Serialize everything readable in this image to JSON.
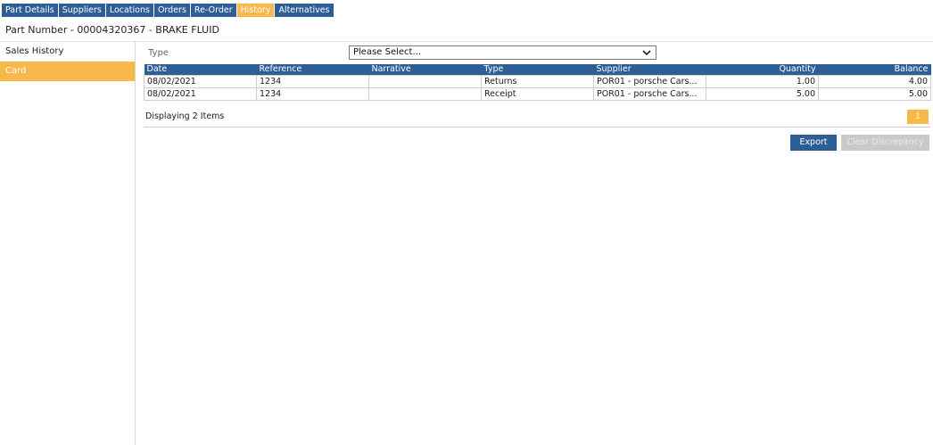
{
  "tabs": [
    {
      "label": "Part Details",
      "active": false
    },
    {
      "label": "Suppliers",
      "active": false
    },
    {
      "label": "Locations",
      "active": false
    },
    {
      "label": "Orders",
      "active": false
    },
    {
      "label": "Re-Order",
      "active": false
    },
    {
      "label": "History",
      "active": true
    },
    {
      "label": "Alternatives",
      "active": false
    }
  ],
  "header": {
    "title": "Part Number - 00004320367 - BRAKE FLUID"
  },
  "sidebar": {
    "items": [
      {
        "label": "Sales History",
        "active": false
      },
      {
        "label": "Card",
        "active": true
      }
    ]
  },
  "filter": {
    "label": "Type",
    "select_value": "Please Select..."
  },
  "table": {
    "columns": [
      "Date",
      "Reference",
      "Narrative",
      "Type",
      "Supplier",
      "Quantity",
      "Balance"
    ],
    "rows": [
      [
        "08/02/2021",
        "1234",
        "",
        "Returns",
        "POR01 - porsche Cars...",
        "1.00",
        "4.00"
      ],
      [
        "08/02/2021",
        "1234",
        "",
        "Receipt",
        "POR01 - porsche Cars...",
        "5.00",
        "5.00"
      ]
    ]
  },
  "footer": {
    "status": "Displaying 2 Items",
    "page": "1"
  },
  "actions": {
    "export_label": "Export",
    "clear_label": "Clear Discrepancy"
  },
  "colors": {
    "primary": "#2d5f96",
    "accent": "#f8b94a",
    "disabled": "#c9c9c9"
  },
  "icons": {
    "select_chevron": "chevron-down-icon"
  }
}
